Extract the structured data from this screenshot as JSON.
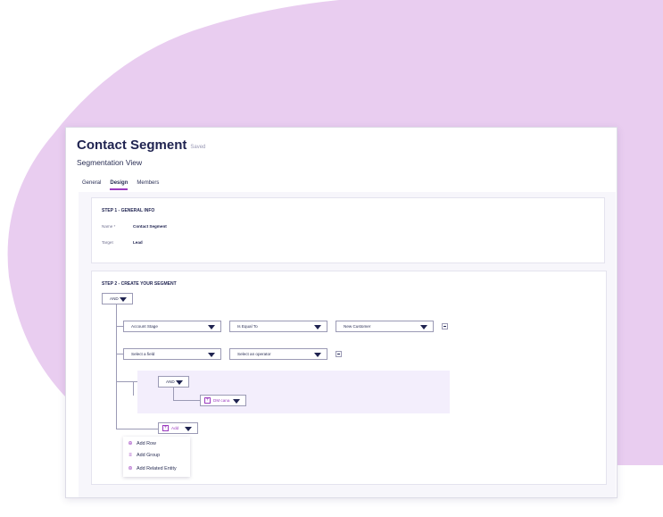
{
  "colors": {
    "blob": "#e9cdf0",
    "accent": "#9b3bbf",
    "title": "#1f2350"
  },
  "header": {
    "title": "Contact Segment",
    "saved": "Saved",
    "subtitle": "Segmentation View"
  },
  "tabs": [
    {
      "label": "General"
    },
    {
      "label": "Design",
      "active": true
    },
    {
      "label": "Members"
    }
  ],
  "step1": {
    "heading": "STEP 1 - GENERAL INFO",
    "name_label": "Name *",
    "name_value": "Contact Segment",
    "target_label": "Target",
    "target_value": "Lead"
  },
  "step2": {
    "heading": "STEP 2 - CREATE YOUR SEGMENT",
    "root_operator": "AND",
    "row1": {
      "field": "Account Stage",
      "operator": "Is Equal To",
      "value": "New Customer"
    },
    "row2": {
      "field_placeholder": "Select a field",
      "operator_placeholder": "Select an operator"
    },
    "group": {
      "operator": "AND",
      "entity": "DM cana"
    },
    "add_button": "Add",
    "add_menu": [
      {
        "label": "Add Row",
        "icon": "plus-circle-icon"
      },
      {
        "label": "Add Group",
        "icon": "group-icon"
      },
      {
        "label": "Add Related Entity",
        "icon": "related-entity-icon"
      }
    ]
  }
}
